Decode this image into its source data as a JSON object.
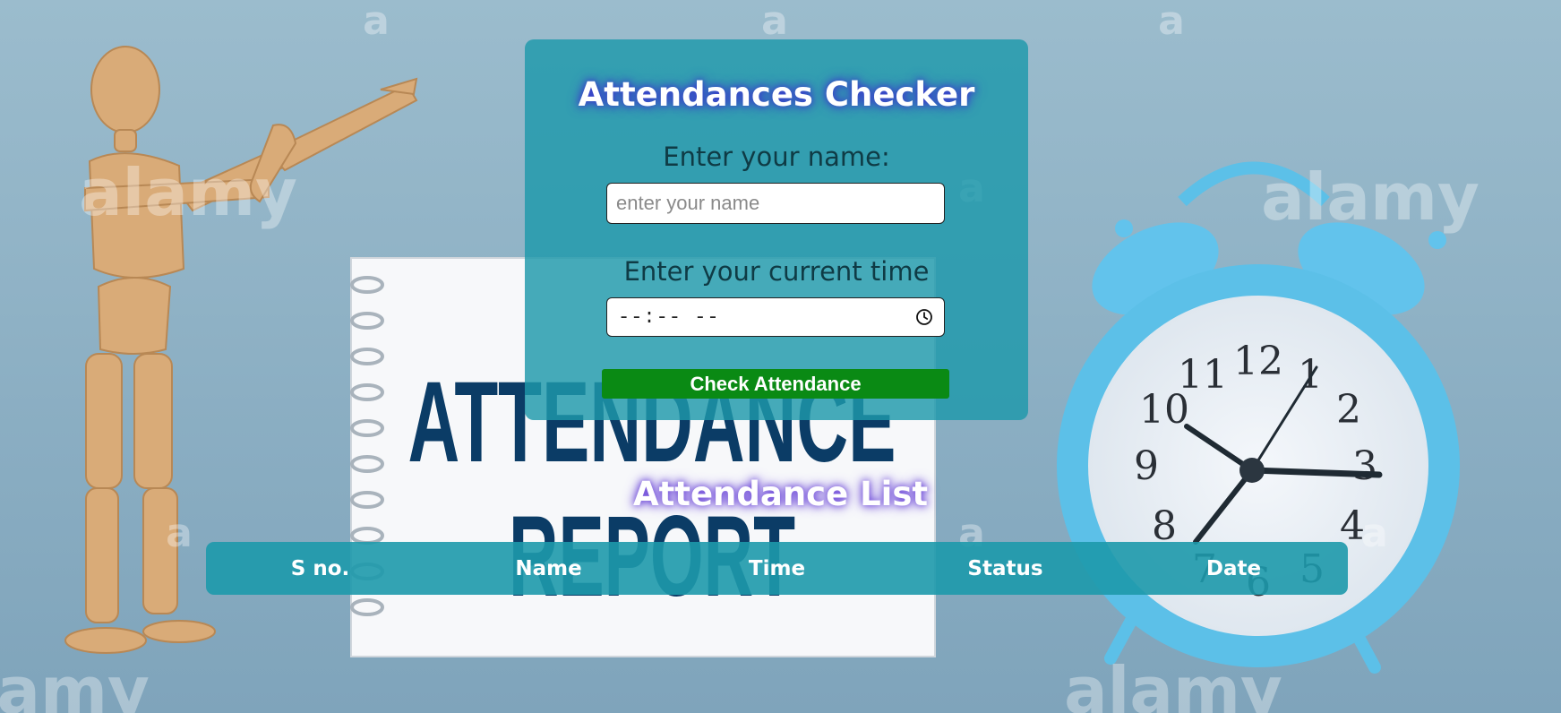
{
  "form": {
    "title": "Attendances Checker",
    "name_label": "Enter your name:",
    "name_placeholder": "enter your name",
    "name_value": "",
    "time_label": "Enter your current time",
    "time_value": "--:--  --",
    "submit_label": "Check Attendance"
  },
  "background": {
    "notebook_line1": "ATTENDANCE",
    "notebook_line2": "REPORT",
    "watermark": "alamy"
  },
  "list": {
    "title": "Attendance List",
    "columns": [
      "S no.",
      "Name",
      "Time",
      "Status",
      "Date"
    ]
  },
  "colors": {
    "card": "#1d99ab",
    "button": "#0a8a14",
    "title_glow": "#3a3acb",
    "notebook_text": "#0b3c66",
    "clock": "#5cc0e8"
  }
}
